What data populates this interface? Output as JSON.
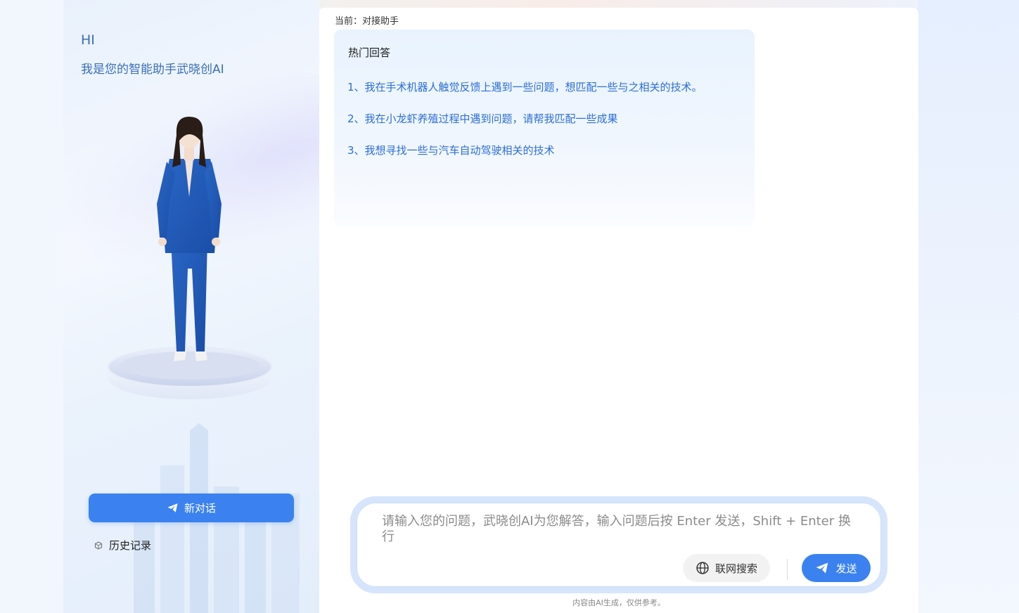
{
  "sidebar": {
    "greeting_title": "HI",
    "greeting_subtitle": "我是您的智能助手武晓创AI",
    "new_chat_label": "新对话",
    "history_label": "历史记录"
  },
  "main": {
    "current_label": "当前：对接助手",
    "hot_answers": {
      "title": "热门回答",
      "items": [
        "1、我在手术机器人触觉反馈上遇到一些问题，想匹配一些与之相关的技术。",
        "2、我在小龙虾养殖过程中遇到问题，请帮我匹配一些成果",
        "3、我想寻找一些与汽车自动驾驶相关的技术"
      ]
    },
    "input": {
      "placeholder": "请输入您的问题，武晓创AI为您解答，输入问题后按 Enter 发送，Shift + Enter 换行",
      "value": ""
    },
    "web_search_label": "联网搜索",
    "send_label": "发送",
    "disclaimer": "内容由AI生成，仅供参考。"
  },
  "colors": {
    "accent": "#3b82f0",
    "link": "#2b6fd6",
    "greeting": "#3a6fb6"
  }
}
